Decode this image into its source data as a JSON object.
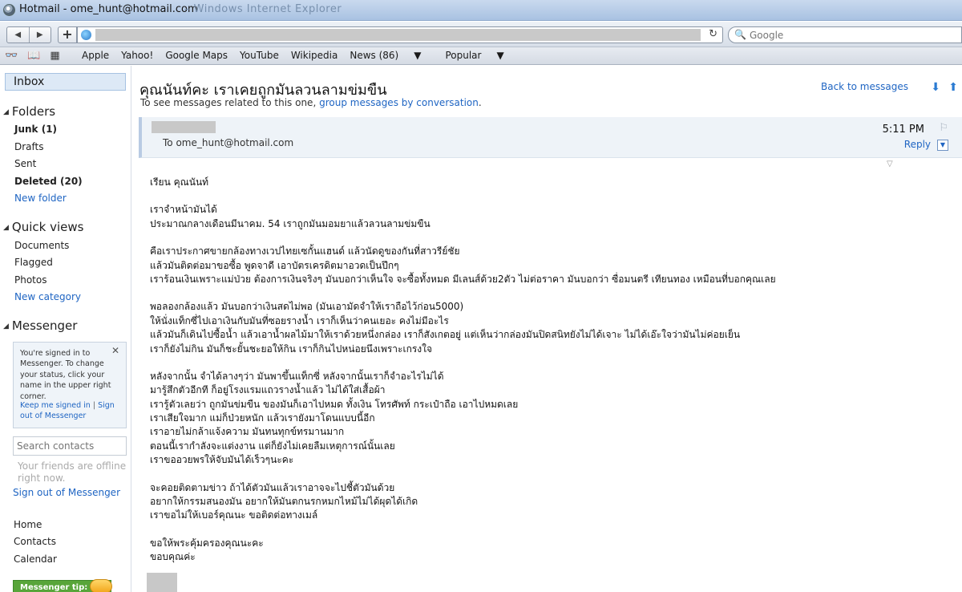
{
  "window": {
    "title": "Hotmail - ome_hunt@hotmail.com",
    "ghost_title": "– Windows Internet Explorer"
  },
  "toolbar": {
    "back_icon": "back-arrow-icon",
    "forward_icon": "forward-arrow-icon",
    "add_tab_label": "+",
    "reload_icon": "reload-icon",
    "search_placeholder": "Google"
  },
  "bookmarks": {
    "items": [
      {
        "label": "Apple"
      },
      {
        "label": "Yahoo!"
      },
      {
        "label": "Google Maps"
      },
      {
        "label": "YouTube"
      },
      {
        "label": "Wikipedia"
      },
      {
        "label": "News (86)"
      },
      {
        "label": "Popular"
      }
    ]
  },
  "sidebar": {
    "inbox": "Inbox",
    "folders_title": "Folders",
    "folders": [
      {
        "label": "Junk (1)",
        "bold": true
      },
      {
        "label": "Drafts",
        "bold": false
      },
      {
        "label": "Sent",
        "bold": false
      },
      {
        "label": "Deleted (20)",
        "bold": true
      }
    ],
    "new_folder": "New folder",
    "quick_views_title": "Quick views",
    "quick_views": [
      "Documents",
      "Flagged",
      "Photos"
    ],
    "new_category": "New category",
    "messenger_title": "Messenger",
    "messenger_notice": "You're signed in to Messenger. To change your status, click your name in the upper right corner.",
    "keep_signed_in": "Keep me signed in",
    "sign_out_short": "Sign out of Messenger",
    "search_contacts_placeholder": "Search contacts",
    "offline_text": "Your friends are offline right now.",
    "sign_out_messenger": "Sign out of Messenger",
    "bottom_links": [
      "Home",
      "Contacts",
      "Calendar"
    ],
    "tip": "Messenger tip:"
  },
  "message": {
    "subject": "คุณนันท์คะ เราเคยถูกมันลวนลามข่มขืน",
    "related_prefix": "To see messages related to this one,",
    "related_link": "group messages by conversation",
    "related_suffix": ".",
    "back_to_messages": "Back to messages",
    "to_line": "To ome_hunt@hotmail.com",
    "time": "5:11 PM",
    "reply": "Reply",
    "body": [
      "เรียน คุณนันท์",
      "",
      "เราจำหน้ามันได้",
      "ประมาณกลางเดือนมีนาคม. 54 เราถูกมันมอมยาแล้วลวนลามข่มขืน",
      "",
      "คือเราประกาศขายกล้องทางเวปไทยเซกั้นแฮนด์ แล้วนัดดูของกันที่สาวรีย์ชัย",
      "แล้วมันติดต่อมาขอซื้อ พูดจาดี เอาบัตรเครดิตมาอวดเป็นปึกๆ",
      "เราร้อนเงินเพราะแม่ป่วย ต้องการเงินจริงๆ มันบอกว่าเห็นใจ จะซื้อทั้งหมด มีเลนส์ด้วย2ตัว ไม่ต่อราคา มันบอกว่า ซื่อมนตรี เทียนทอง เหมือนที่บอกคุณเลย",
      "",
      "พอลองกล้องแล้ว มันบอกว่าเงินสดไม่พอ (มันเอามัดจำให้เราถือไว้ก่อน5000)",
      "ให้นั่งแท็กซี่ไปเอาเงินกับมันที่ซอยรางน้ำ เราก็เห็นว่าคนเยอะ คงไม่มีอะไร",
      "แล้วมันก็เดินไปซื้อน้ำ แล้วเอาน้ำผลไม้มาให้เราด้วยหนึ่งกล่อง เราก็สังเกตอยู่ แต่เห็นว่ากล่องมันปิดสนิทยังไม่ได้เจาะ ไม่ได้เอ๊ะใจว่ามันไม่ค่อยเย็น",
      "เราก็ยังไม่กิน มันก็ชะยั้นชะยอให้กิน เราก็กินไปหน่อยนึงเพราะเกรงใจ",
      "",
      "หลังจากนั้น จำได้ลางๆว่า มันพาขึ้นแท็กซี่ หลังจากนั้นเราก็จำอะไรไม่ได้",
      "มารู้สึกตัวอีกที ก็อยู่โรงแรมแถวรางน้ำแล้ว ไม่ได้ใส่เสื้อผ้า",
      "เรารู้ตัวเลยว่า ถูกมันข่มขืน ของมันก็เอาไปหมด ทั้งเงิน โทรศัพท์ กระเป๋าถือ เอาไปหมดเลย",
      "เราเสียใจมาก แม่ก็ป่วยหนัก แล้วเรายังมาโดนแบบนี้อีก",
      "เราอายไม่กล้าแจ้งความ มันทนทุกข์ทรมานมาก",
      "ตอนนี้เรากำลังจะแต่งงาน แต่ก็ยังไม่เคยลืมเหตุการณ์นั้นเลย",
      "เราขออวยพรให้จับมันได้เร็วๆนะคะ",
      "",
      "จะคอยติดตามข่าว ถ้าได้ตัวมันแล้วเราอาจจะไปชี้ตัวมันด้วย",
      "อยากให้กรรมสนองมัน อยากให้มันตกนรกหมกไหม้ไม่ได้ผุดได้เกิด",
      "เราขอไม่ให้เบอร์คุณนะ ขอติดต่อทางเมล์",
      "",
      "ขอให้พระคุ้มครองคุณนะคะ",
      "ขอบคุณค่ะ"
    ]
  }
}
